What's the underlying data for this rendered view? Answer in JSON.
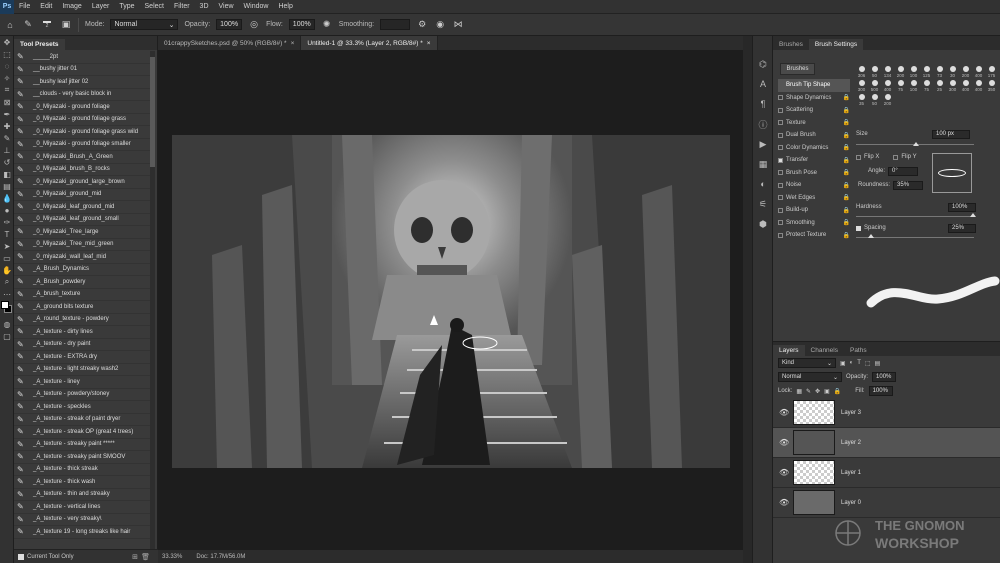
{
  "menubar": {
    "logo": "Ps",
    "items": [
      "File",
      "Edit",
      "Image",
      "Layer",
      "Type",
      "Select",
      "Filter",
      "3D",
      "View",
      "Window",
      "Help"
    ]
  },
  "optbar": {
    "brush_size": "2",
    "mode_label": "Mode:",
    "mode_value": "Normal",
    "opacity_label": "Opacity:",
    "opacity_value": "100%",
    "flow_label": "Flow:",
    "flow_value": "100%",
    "smoothing_label": "Smoothing:",
    "smoothing_value": ""
  },
  "presets": {
    "tab": "Tool Presets",
    "items": [
      "_____2pt",
      "__bushy jitter 01",
      "__bushy leaf jitter 02",
      "__clouds - very basic block in",
      "_0_Miyazaki - ground foliage",
      "_0_Miyazaki - ground foliage grass",
      "_0_Miyazaki - ground foliage grass wild",
      "_0_Miyazaki - ground foliage smaller",
      "_0_Miyazaki_Brush_A_Green",
      "_0_Miyazaki_brush_B_rocks",
      "_0_Miyazaki_ground_large_brown",
      "_0_Miyazaki_ground_mid",
      "_0_Miyazaki_leaf_ground_mid",
      "_0_Miyazaki_leaf_ground_small",
      "_0_Miyazaki_Tree_large",
      "_0_Miyazaki_Tree_mid_green",
      "_0_miyazaki_wall_leaf_mid",
      "_A_Brush_Dynamics",
      "_A_Brush_powdery",
      "_A_brush_texture",
      "_A_ground bits texture",
      "_A_round_texture - powdery",
      "_A_texture - dirty lines",
      "_A_texture - dry paint",
      "_A_texture - EXTRA dry",
      "_A_texture - light streaky wash2",
      "_A_texture - liney",
      "_A_texture - powdery/stoney",
      "_A_texture - speckles",
      "_A_texture - streak of paint dryer",
      "_A_texture - streak OP (great 4 trees)",
      "_A_texture - streaky paint *****",
      "_A_texture - streaky paint SMOOV",
      "_A_texture - thick streak",
      "_A_texture - thick wash",
      "_A_texture - thin and streaky",
      "_A_texture - vertical lines",
      "_A_texture - very streaky\\",
      "_A_texture 19 - long streaks like hair"
    ],
    "footer": "Current Tool Only"
  },
  "tabs": [
    {
      "label": "01crappySketches.psd @ 50% (RGB/8#) *"
    },
    {
      "label": "Untitled-1 @ 33.3% (Layer 2, RGB/8#) *"
    }
  ],
  "status": {
    "zoom": "33.33%",
    "doc": "Doc: 17.7M/56.0M"
  },
  "brush_panel": {
    "tabs": [
      "Brushes",
      "Brush Settings"
    ],
    "brushes_button": "Brushes",
    "options": [
      {
        "label": "Brush Tip Shape",
        "checked": false,
        "selected": true
      },
      {
        "label": "Shape Dynamics",
        "checked": false
      },
      {
        "label": "Scattering",
        "checked": false
      },
      {
        "label": "Texture",
        "checked": false
      },
      {
        "label": "Dual Brush",
        "checked": false
      },
      {
        "label": "Color Dynamics",
        "checked": false
      },
      {
        "label": "Transfer",
        "checked": true
      },
      {
        "label": "Brush Pose",
        "checked": false
      },
      {
        "label": "Noise",
        "checked": false
      },
      {
        "label": "Wet Edges",
        "checked": false
      },
      {
        "label": "Build-up",
        "checked": false
      },
      {
        "label": "Smoothing",
        "checked": false
      },
      {
        "label": "Protect Texture",
        "checked": false
      }
    ],
    "tip_sizes": [
      "306",
      "50",
      "134",
      "200",
      "100",
      "125",
      "73",
      "30",
      "200",
      "400",
      "175",
      "300",
      "500",
      "400",
      "75",
      "100",
      "75",
      "25",
      "300",
      "400",
      "400",
      "350",
      "35",
      "50",
      "200"
    ],
    "size_label": "Size",
    "size_value": "100 px",
    "flipx": "Flip X",
    "flipy": "Flip Y",
    "angle_label": "Angle:",
    "angle_value": "0°",
    "roundness_label": "Roundness:",
    "roundness_value": "35%",
    "hardness_label": "Hardness",
    "hardness_value": "100%",
    "spacing_label": "Spacing",
    "spacing_value": "25%"
  },
  "layers_panel": {
    "tabs": [
      "Layers",
      "Channels",
      "Paths"
    ],
    "kind": "Kind",
    "blend": "Normal",
    "opacity_label": "Opacity:",
    "opacity_value": "100%",
    "lock_label": "Lock:",
    "fill_label": "Fill:",
    "fill_value": "100%",
    "layers": [
      {
        "name": "Layer 3",
        "active": false
      },
      {
        "name": "Layer 2",
        "active": true
      },
      {
        "name": "Layer 1",
        "active": false
      },
      {
        "name": "Layer 0",
        "active": false
      }
    ]
  },
  "watermark": {
    "line1": "THE GNOMON",
    "line2": "WORKSHOP"
  }
}
